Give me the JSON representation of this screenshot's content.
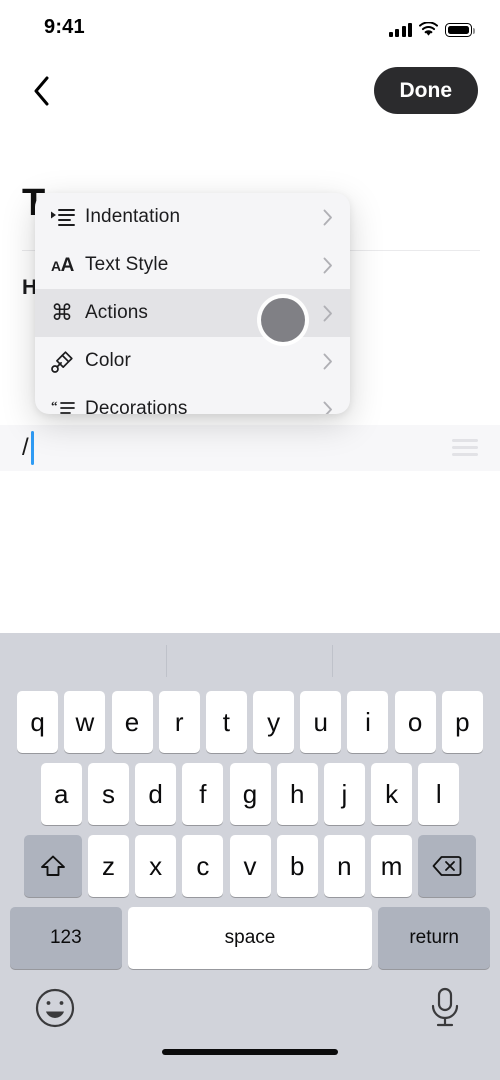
{
  "status_bar": {
    "time": "9:41",
    "icons": [
      "cellular-signal-icon",
      "wifi-icon",
      "battery-icon"
    ]
  },
  "nav_bar": {
    "back_icon": "chevron-left-icon",
    "done_label": "Done"
  },
  "document": {
    "title": "T",
    "subtitle": "H",
    "editor_line_text": "/",
    "drag_handle_icon": "drag-handle-icon"
  },
  "context_menu": {
    "items": [
      {
        "label": "Indentation",
        "icon": "indentation-icon",
        "selected": false
      },
      {
        "label": "Text Style",
        "icon": "text-style-icon",
        "selected": false
      },
      {
        "label": "Actions",
        "icon": "command-icon",
        "selected": true
      },
      {
        "label": "Color",
        "icon": "paintbrush-icon",
        "selected": false
      },
      {
        "label": "Decorations",
        "icon": "quote-icon",
        "selected": false
      }
    ],
    "chevron_icon": "chevron-right-icon",
    "highlight_color": "#E3E3E6",
    "background_color": "#F5F5F7"
  },
  "touch_indicator": {
    "name": "touch-point",
    "color": "#808085"
  },
  "keyboard": {
    "row1": [
      "q",
      "w",
      "e",
      "r",
      "t",
      "y",
      "u",
      "i",
      "o",
      "p"
    ],
    "row2": [
      "a",
      "s",
      "d",
      "f",
      "g",
      "h",
      "j",
      "k",
      "l"
    ],
    "row3": [
      "z",
      "x",
      "c",
      "v",
      "b",
      "n",
      "m"
    ],
    "shift_icon": "shift-icon",
    "backspace_icon": "backspace-icon",
    "numbers_label": "123",
    "space_label": "space",
    "return_label": "return",
    "emoji_icon": "emoji-icon",
    "microphone_icon": "microphone-icon",
    "background_color": "#D1D3DA",
    "special_key_color": "#AEB3BE"
  }
}
